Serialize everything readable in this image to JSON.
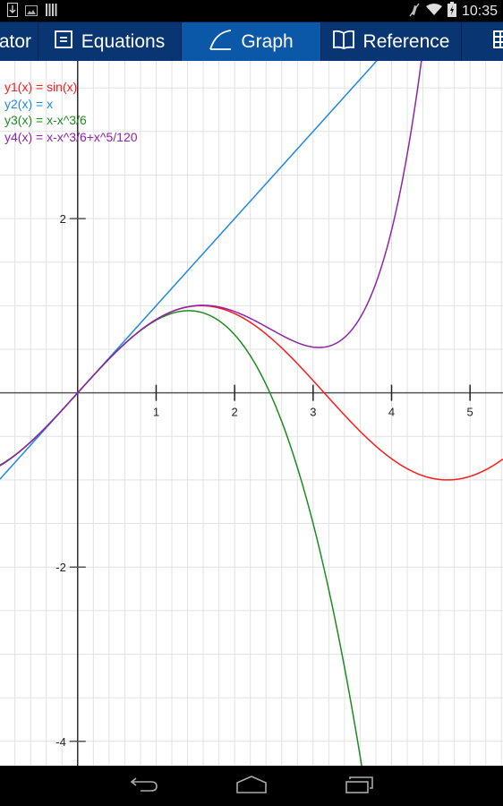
{
  "status_bar": {
    "left_icons": [
      "download-icon",
      "image-icon",
      "barcode-icon"
    ],
    "right_icons": [
      "mute-icon",
      "wifi-icon",
      "battery-charging-icon"
    ],
    "time": "10:35"
  },
  "tabs": [
    {
      "label": "ator",
      "icon": "none",
      "selected": false
    },
    {
      "label": "Equations",
      "icon": "equals-box-icon",
      "selected": false
    },
    {
      "label": "Graph",
      "icon": "graph-curve-icon",
      "selected": true
    },
    {
      "label": "Reference",
      "icon": "book-icon",
      "selected": false
    },
    {
      "label": "",
      "icon": "table-icon",
      "selected": false
    }
  ],
  "graph": {
    "legend": [
      {
        "label": "y1(x) = sin(x)",
        "color": "#ff1a1a"
      },
      {
        "label": "y2(x) = x",
        "color": "#1e88e5"
      },
      {
        "label": "y3(x) = x-x^3/6",
        "color": "#1f8a1f"
      },
      {
        "label": "y4(x) = x-x^3/6+x^5/120",
        "color": "#8e24aa"
      }
    ],
    "x_ticks": [
      "1",
      "2",
      "3",
      "4",
      "5"
    ],
    "y_ticks": [
      "2",
      "-2",
      "-4"
    ],
    "x_range": [
      -0.99,
      5.42
    ],
    "y_range": [
      -4.28,
      3.81
    ],
    "grid": {
      "x_step": 0.2,
      "y_step": 0.5
    }
  },
  "chart_data": {
    "type": "line",
    "title": "",
    "xlabel": "",
    "ylabel": "",
    "xlim": [
      -0.99,
      5.42
    ],
    "ylim": [
      -4.28,
      3.81
    ],
    "x_ticks": [
      1,
      2,
      3,
      4,
      5
    ],
    "y_ticks": [
      2,
      -2,
      -4
    ],
    "grid": true,
    "legend": "top-left",
    "series": [
      {
        "name": "y1(x) = sin(x)",
        "expr": "sin(x)",
        "color": "#ff1a1a"
      },
      {
        "name": "y2(x) = x",
        "expr": "x",
        "color": "#1e88e5"
      },
      {
        "name": "y3(x) = x-x^3/6",
        "expr": "x-x^3/6",
        "color": "#1f8a1f"
      },
      {
        "name": "y4(x) = x-x^3/6+x^5/120",
        "expr": "x-x^3/6+x^5/120",
        "color": "#8e24aa"
      }
    ]
  },
  "nav_bar": {
    "buttons": [
      "back-icon",
      "home-icon",
      "recents-icon"
    ]
  }
}
